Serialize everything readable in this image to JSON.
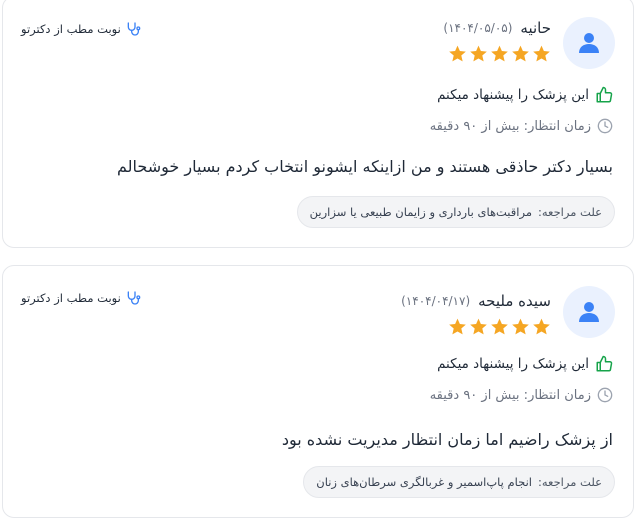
{
  "colors": {
    "star": "#f5a623",
    "accent_blue": "#3b82f6",
    "thumb_green": "#16a34a",
    "avatar_bg": "#eaf1fe"
  },
  "reviews": [
    {
      "name": "حانیه",
      "date": "(۱۴۰۴/۰۵/۰۵)",
      "rating": 5,
      "visit_link": "نوبت مطب از دکترتو",
      "recommend": "این پزشک را پیشنهاد میکنم",
      "wait": "زمان انتظار: بیش از ۹۰ دقیقه",
      "comment": "بسیار دکتر حاذقی هستند و من ازاینکه ایشونو انتخاب کردم بسیار خوشحالم",
      "reason_label": "علت مراجعه:",
      "reason_value": "مراقبت‌های بارداری و زایمان طبیعی یا سزارین"
    },
    {
      "name": "سیده ملیحه",
      "date": "(۱۴۰۴/۰۴/۱۷)",
      "rating": 5,
      "visit_link": "نوبت مطب از دکترتو",
      "recommend": "این پزشک را پیشنهاد میکنم",
      "wait": "زمان انتظار: بیش از ۹۰ دقیقه",
      "comment": "از پزشک راضیم اما زمان انتظار مدیریت نشده بود",
      "reason_label": "علت مراجعه:",
      "reason_value": "انجام پاپ‌اسمیر و غربالگری سرطان‌های زنان"
    }
  ]
}
